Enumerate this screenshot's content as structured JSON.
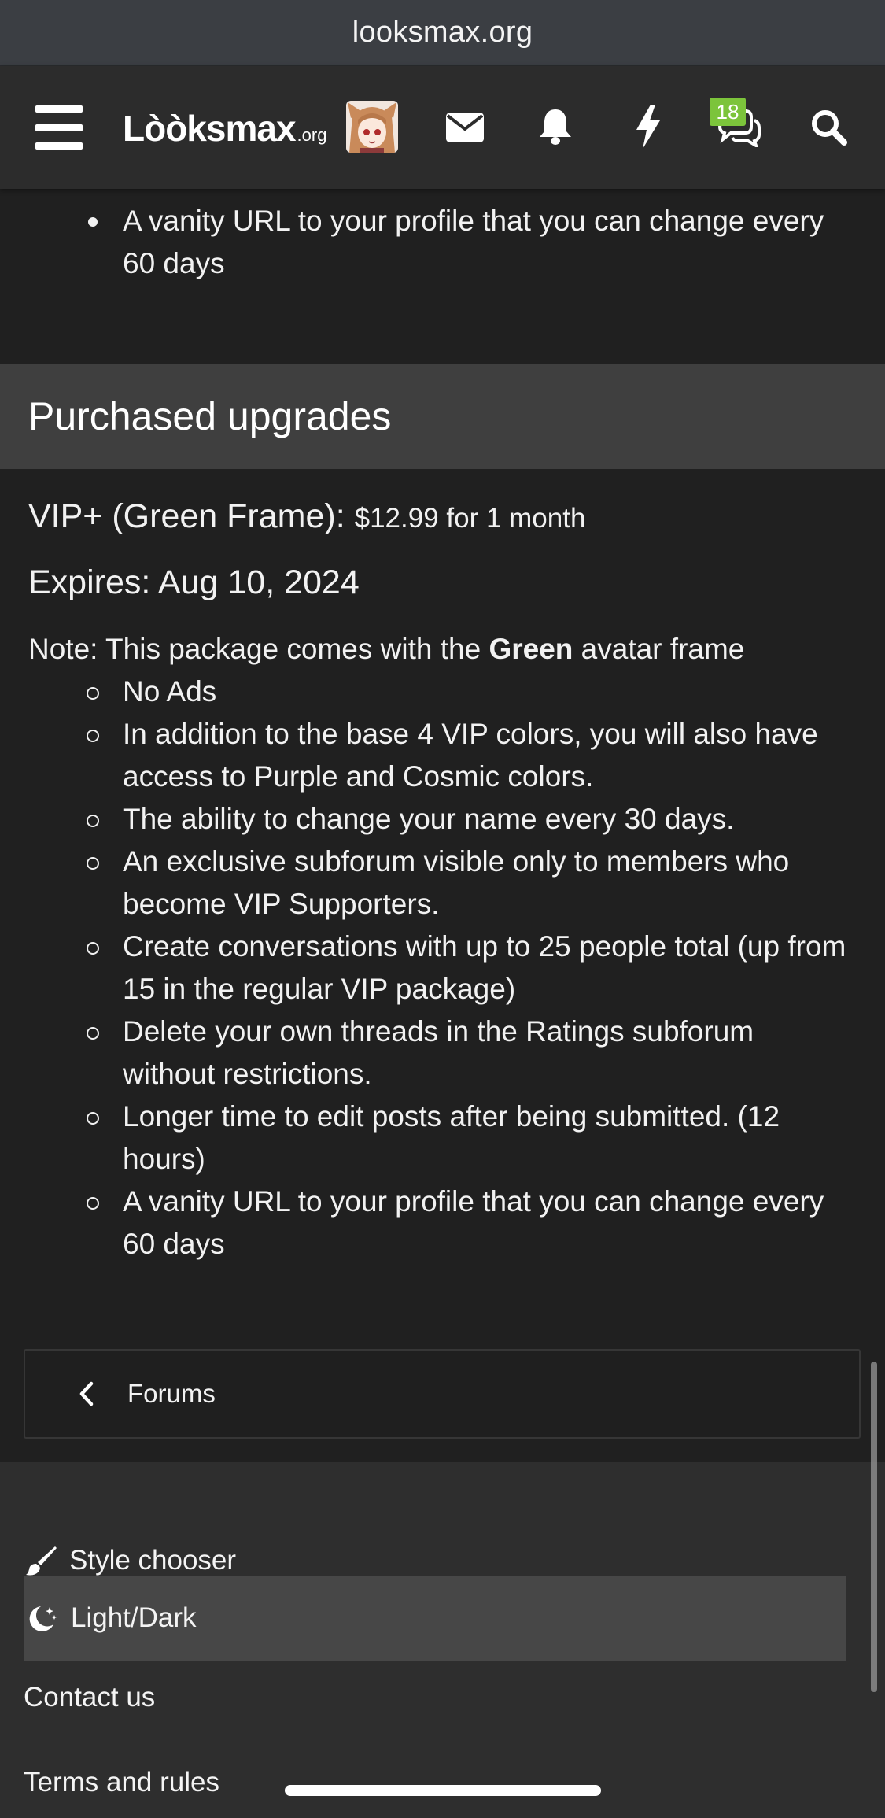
{
  "browser": {
    "url": "looksmax.org"
  },
  "header": {
    "logo_main": "Lòòksmax",
    "logo_suffix": ".org",
    "chat_badge": "18"
  },
  "top_list": [
    "A vanity URL to your profile that you can change every 60 days"
  ],
  "section": {
    "title": "Purchased upgrades"
  },
  "package": {
    "name": "VIP+ (Green Frame):",
    "price": "$12.99 for 1 month",
    "expires": "Expires: Aug 10, 2024",
    "note_prefix": "Note: This package comes with the",
    "note_bold": "Green",
    "note_suffix": "avatar frame",
    "features": [
      "No Ads",
      "In addition to the base 4 VIP colors, you will also have access to Purple and Cosmic colors.",
      "The ability to change your name every 30 days.",
      "An exclusive subforum visible only to members who become VIP Supporters.",
      "Create conversations with up to 25 people total (up from 15 in the regular VIP package)",
      "Delete your own threads in the Ratings subforum without restrictions.",
      "Longer time to edit posts after being submitted. (12 hours)",
      "A vanity URL to your profile that you can change every 60 days"
    ]
  },
  "back_link": {
    "label": "Forums"
  },
  "footer": {
    "style_chooser": "Style chooser",
    "light_dark": "Light/Dark",
    "contact": "Contact us",
    "terms": "Terms and rules"
  },
  "colors": {
    "badge": "#7cc43b",
    "background": "#202020",
    "header": "#2c2c2c",
    "section_head": "#3f3f3f"
  }
}
